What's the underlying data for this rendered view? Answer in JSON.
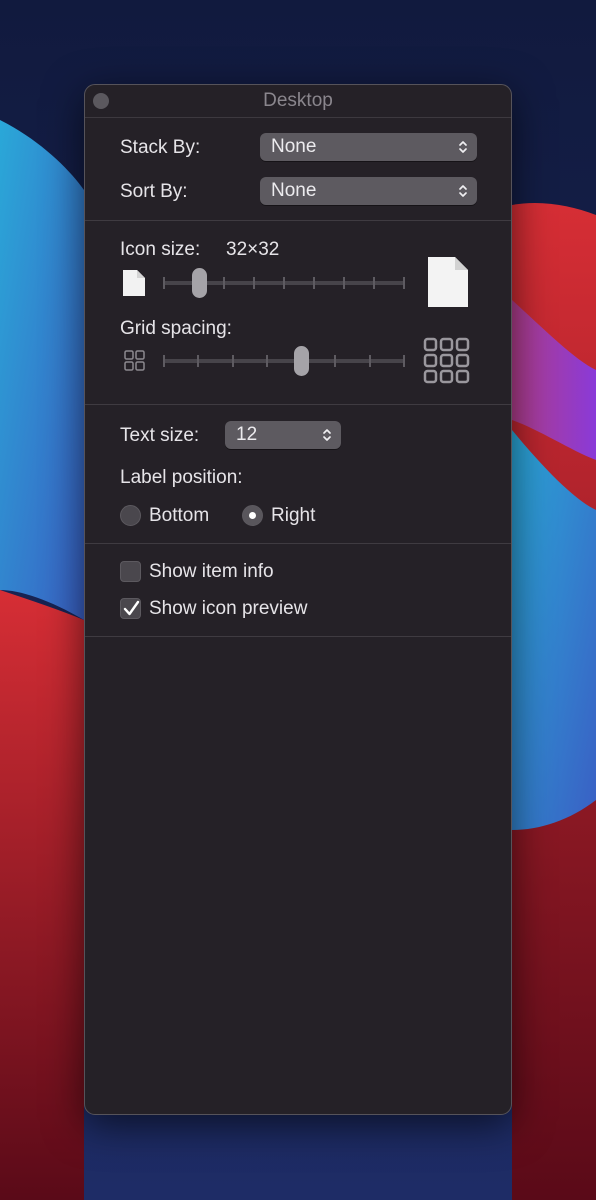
{
  "window": {
    "title": "Desktop"
  },
  "arrange": {
    "stack_by": {
      "label": "Stack By:",
      "value": "None"
    },
    "sort_by": {
      "label": "Sort By:",
      "value": "None"
    }
  },
  "icon_size": {
    "label": "Icon size:",
    "value_text": "32×32",
    "slider_level": 0.15,
    "tick_count": 9
  },
  "grid_spacing": {
    "label": "Grid spacing:",
    "slider_level": 0.57,
    "tick_count": 8
  },
  "text_size": {
    "label": "Text size:",
    "value": "12"
  },
  "label_position": {
    "label": "Label position:",
    "options": [
      "Bottom",
      "Right"
    ],
    "selected": "Right"
  },
  "options": {
    "show_item_info": {
      "label": "Show item info",
      "checked": false
    },
    "show_icon_preview": {
      "label": "Show icon preview",
      "checked": true
    }
  },
  "icons": {
    "small_icon": "document-small-icon",
    "large_icon": "document-large-icon",
    "grid_small": "grid-tight-icon",
    "grid_large": "grid-wide-icon",
    "chevrons": "up-down-chevron-icon",
    "checkmark": "checkmark-icon"
  },
  "colors": {
    "panel": "#252127",
    "popup": "#5d5a60",
    "text": "#e6e4e8"
  }
}
